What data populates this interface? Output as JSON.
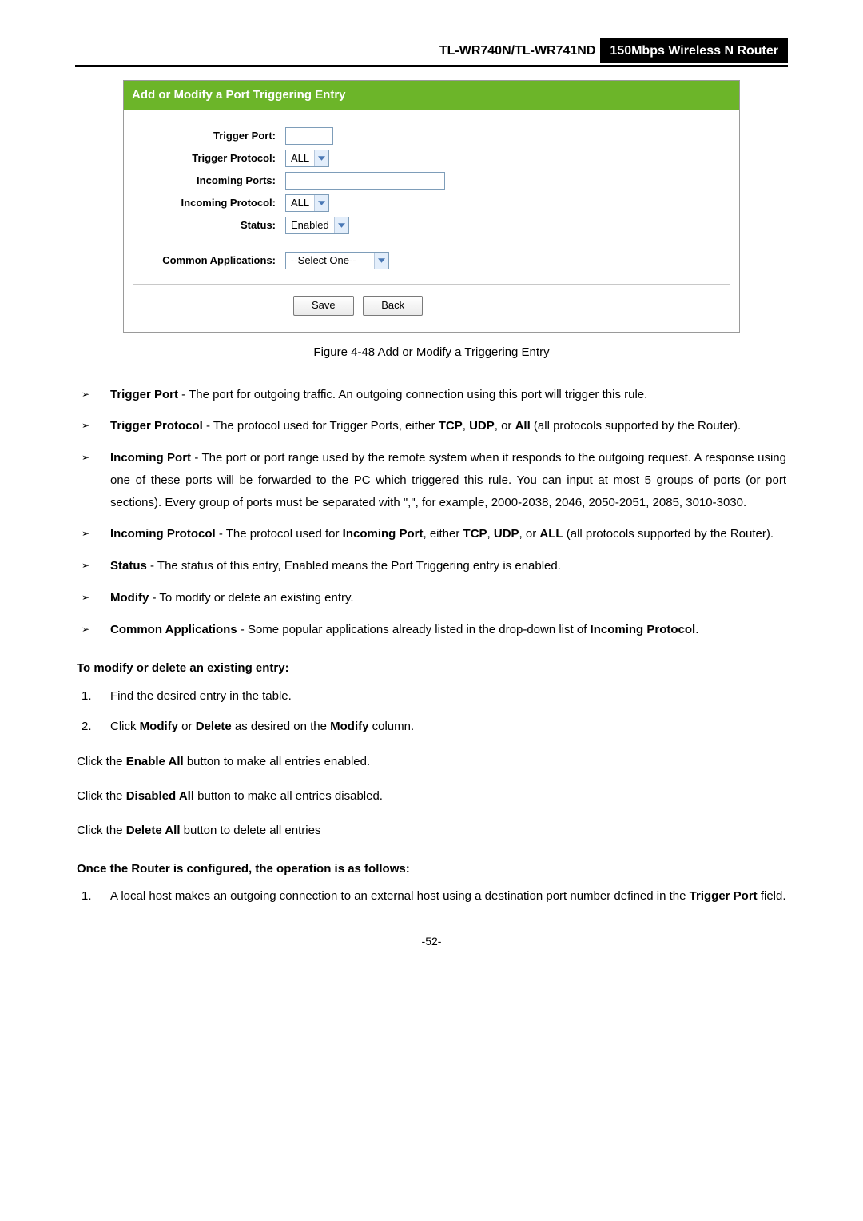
{
  "header": {
    "model": "TL-WR740N/TL-WR741ND",
    "product": "150Mbps Wireless N Router"
  },
  "screenshot": {
    "title": "Add or Modify a Port Triggering Entry",
    "labels": {
      "trigger_port": "Trigger Port:",
      "trigger_protocol": "Trigger Protocol:",
      "incoming_ports": "Incoming Ports:",
      "incoming_protocol": "Incoming Protocol:",
      "status": "Status:",
      "common_apps": "Common Applications:"
    },
    "values": {
      "trigger_port": "",
      "trigger_protocol": "ALL",
      "incoming_ports": "",
      "incoming_protocol": "ALL",
      "status": "Enabled",
      "common_apps": "--Select One--"
    },
    "buttons": {
      "save": "Save",
      "back": "Back"
    }
  },
  "caption": "Figure 4-48    Add or Modify a Triggering Entry",
  "bullets": {
    "trigger_port": {
      "term": "Trigger Port",
      "text": " - The port for outgoing traffic. An outgoing connection using this port will trigger this rule."
    },
    "trigger_protocol": {
      "term": "Trigger Protocol",
      "text_a": " - The protocol used for Trigger Ports, either ",
      "tcp": "TCP",
      "comma1": ", ",
      "udp": "UDP",
      "comma2": ", or ",
      "all": "All",
      "text_b": " (all protocols supported by the Router)."
    },
    "incoming_port": {
      "term": "Incoming Port",
      "text": " - The port or port range used by the remote system when it responds to the outgoing request. A response using one of these ports will be forwarded to the PC which triggered this rule. You can input at most 5 groups of ports (or port sections). Every group of ports must be separated with \",\", for example, 2000-2038, 2046, 2050-2051, 2085, 3010-3030."
    },
    "incoming_protocol": {
      "term": "Incoming Protocol",
      "text_a": " - The protocol used for ",
      "inc_port": "Incoming Port",
      "text_b": ", either ",
      "tcp": "TCP",
      "comma1": ", ",
      "udp": "UDP",
      "comma2": ", or ",
      "all": "ALL",
      "text_c": " (all protocols supported by the Router)."
    },
    "status": {
      "term": "Status",
      "text": " - The status of this entry, Enabled means the Port Triggering entry is enabled."
    },
    "modify": {
      "term": "Modify",
      "text": " - To modify or delete an existing entry."
    },
    "common_apps": {
      "term": "Common Applications",
      "text_a": " - Some popular applications already listed in the drop-down list of ",
      "inc_proto": "Incoming Protocol",
      "text_b": "."
    }
  },
  "section1_head": "To modify or delete an existing entry:",
  "steps1": {
    "s1": {
      "n": "1.",
      "text": "Find the desired entry in the table."
    },
    "s2": {
      "n": "2.",
      "t1": "Click ",
      "b1": "Modify",
      "t2": " or ",
      "b2": "Delete",
      "t3": " as desired on the ",
      "b3": "Modify",
      "t4": " column."
    }
  },
  "para_enable": {
    "t1": "Click the ",
    "b": "Enable All",
    "t2": " button to make all entries enabled."
  },
  "para_disable": {
    "t1": "Click the ",
    "b": "Disabled All",
    "t2": " button to make all entries disabled."
  },
  "para_delete": {
    "t1": "Click the ",
    "b": "Delete All",
    "t2": " button to delete all entries"
  },
  "section2_head": "Once the Router is configured, the operation is as follows:",
  "steps2": {
    "s1": {
      "n": "1.",
      "t1": "A local host makes an outgoing connection to an external host using a destination port number defined in the ",
      "b": "Trigger Port",
      "t2": " field."
    }
  },
  "page": "-52-"
}
